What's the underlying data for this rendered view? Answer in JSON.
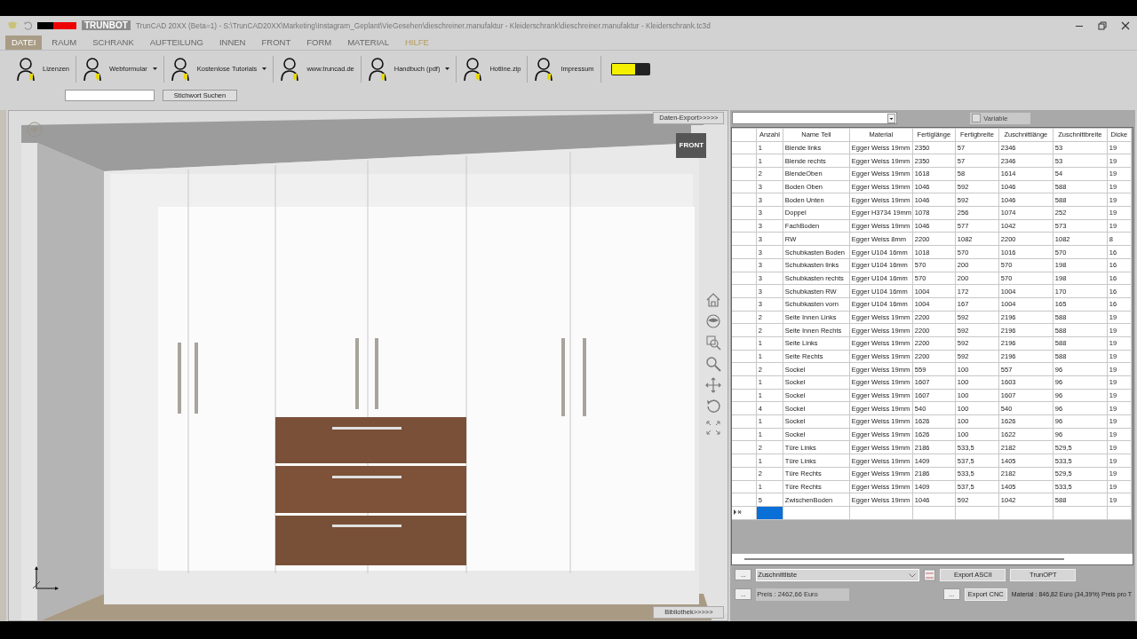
{
  "title_bar": {
    "app_name": "TRUNBOT",
    "title": "TrunCAD 20XX (Beta=1) - S:\\TrunCAD20XX\\Marketing\\Instagram_Geplant\\VieGesehen\\dieschreiner.manufaktur - Kleiderschrank\\dieschreiner.manufaktur - Kleiderschrank.tc3d"
  },
  "menu": [
    {
      "label": "DATEI",
      "selected": true,
      "kind": "normal"
    },
    {
      "label": "RAUM",
      "selected": false,
      "kind": "normal"
    },
    {
      "label": "SCHRANK",
      "selected": false,
      "kind": "normal"
    },
    {
      "label": "AUFTEILUNG",
      "selected": false,
      "kind": "normal"
    },
    {
      "label": "INNEN",
      "selected": false,
      "kind": "normal"
    },
    {
      "label": "FRONT",
      "selected": false,
      "kind": "normal"
    },
    {
      "label": "FORM",
      "selected": false,
      "kind": "normal"
    },
    {
      "label": "MATERIAL",
      "selected": false,
      "kind": "normal"
    },
    {
      "label": "HILFE",
      "selected": false,
      "kind": "help"
    }
  ],
  "ribbon": {
    "items": [
      {
        "label": "Lizenzen",
        "dropdown": false
      },
      {
        "label": "Webformular",
        "dropdown": true
      },
      {
        "label": "Kostenlose Tutorials",
        "dropdown": true
      },
      {
        "label": "www.truncad.de",
        "dropdown": false
      },
      {
        "label": "Handbuch (pdf)",
        "dropdown": true
      },
      {
        "label": "Hotline.zip",
        "dropdown": false
      },
      {
        "label": "Impressum",
        "dropdown": false
      }
    ],
    "search_button": "Stichwort Suchen"
  },
  "viewport": {
    "export_button": "Daten-Export>>>>>",
    "library_button": "Bibliothek>>>>>",
    "view_cube": "FRONT"
  },
  "parts_panel": {
    "variable": {
      "label": "Variable",
      "checked": false
    },
    "columns": [
      "Anzahl",
      "Name Teil",
      "Material",
      "Fertiglänge",
      "Fertigbreite",
      "Zuschnittlänge",
      "Zuschnittbreite",
      "Dicke"
    ],
    "rows": [
      [
        "1",
        "Blende links",
        "Egger Weiss 19mm",
        "2350",
        "57",
        "2346",
        "53",
        "19"
      ],
      [
        "1",
        "Blende rechts",
        "Egger Weiss 19mm",
        "2350",
        "57",
        "2346",
        "53",
        "19"
      ],
      [
        "2",
        "BlendeOben",
        "Egger Weiss 19mm",
        "1618",
        "58",
        "1614",
        "54",
        "19"
      ],
      [
        "3",
        "Boden Oben",
        "Egger Weiss 19mm",
        "1046",
        "592",
        "1046",
        "588",
        "19"
      ],
      [
        "3",
        "Boden Unten",
        "Egger Weiss 19mm",
        "1046",
        "592",
        "1046",
        "588",
        "19"
      ],
      [
        "3",
        "Doppel",
        "Egger H3734 19mm",
        "1078",
        "256",
        "1074",
        "252",
        "19"
      ],
      [
        "3",
        "FachBoden",
        "Egger Weiss 19mm",
        "1046",
        "577",
        "1042",
        "573",
        "19"
      ],
      [
        "3",
        "RW",
        "Egger Weiss 8mm",
        "2200",
        "1082",
        "2200",
        "1082",
        "8"
      ],
      [
        "3",
        "Schubkasten Boden",
        "Egger U104 16mm",
        "1018",
        "570",
        "1016",
        "570",
        "16"
      ],
      [
        "3",
        "Schubkasten links",
        "Egger U104 16mm",
        "570",
        "200",
        "570",
        "198",
        "16"
      ],
      [
        "3",
        "Schubkasten rechts",
        "Egger U104 16mm",
        "570",
        "200",
        "570",
        "198",
        "16"
      ],
      [
        "3",
        "Schubkasten RW",
        "Egger U104 16mm",
        "1004",
        "172",
        "1004",
        "170",
        "16"
      ],
      [
        "3",
        "Schubkasten vorn",
        "Egger U104 16mm",
        "1004",
        "167",
        "1004",
        "165",
        "16"
      ],
      [
        "2",
        "Seite Innen Links",
        "Egger Weiss 19mm",
        "2200",
        "592",
        "2196",
        "588",
        "19"
      ],
      [
        "2",
        "Seite Innen Rechts",
        "Egger Weiss 19mm",
        "2200",
        "592",
        "2196",
        "588",
        "19"
      ],
      [
        "1",
        "Seite Links",
        "Egger Weiss 19mm",
        "2200",
        "592",
        "2196",
        "588",
        "19"
      ],
      [
        "1",
        "Seite Rechts",
        "Egger Weiss 19mm",
        "2200",
        "592",
        "2196",
        "588",
        "19"
      ],
      [
        "2",
        "Sockel",
        "Egger Weiss 19mm",
        "559",
        "100",
        "557",
        "96",
        "19"
      ],
      [
        "1",
        "Sockel",
        "Egger Weiss 19mm",
        "1607",
        "100",
        "1603",
        "96",
        "19"
      ],
      [
        "1",
        "Sockel",
        "Egger Weiss 19mm",
        "1607",
        "100",
        "1607",
        "96",
        "19"
      ],
      [
        "4",
        "Sockel",
        "Egger Weiss 19mm",
        "540",
        "100",
        "540",
        "96",
        "19"
      ],
      [
        "1",
        "Sockel",
        "Egger Weiss 19mm",
        "1626",
        "100",
        "1626",
        "96",
        "19"
      ],
      [
        "1",
        "Sockel",
        "Egger Weiss 19mm",
        "1626",
        "100",
        "1622",
        "96",
        "19"
      ],
      [
        "2",
        "Türe Links",
        "Egger Weiss 19mm",
        "2186",
        "533,5",
        "2182",
        "529,5",
        "19"
      ],
      [
        "1",
        "Türe Links",
        "Egger Weiss 19mm",
        "1409",
        "537,5",
        "1405",
        "533,5",
        "19"
      ],
      [
        "2",
        "Türe Rechts",
        "Egger Weiss 19mm",
        "2186",
        "533,5",
        "2182",
        "529,5",
        "19"
      ],
      [
        "1",
        "Türe Rechts",
        "Egger Weiss 19mm",
        "1409",
        "537,5",
        "1405",
        "533,5",
        "19"
      ],
      [
        "5",
        "ZwischenBoden",
        "Egger Weiss 19mm",
        "1046",
        "592",
        "1042",
        "588",
        "19"
      ]
    ],
    "list_more_button": "...",
    "list_select": "Zuschnittliste",
    "export_ascii": "Export ASCII",
    "trunopt": "TrunOPT",
    "price_more_button": "...",
    "price": "Preis : 2462,66 Euro",
    "cnc_more_button": "...",
    "export_cnc": "Export CNC",
    "material": "Material : 846,82 Euro (34,39%)  Preis pro T"
  }
}
